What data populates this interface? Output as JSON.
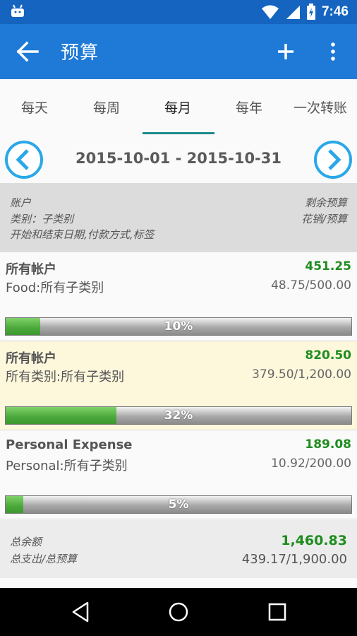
{
  "status": {
    "time": "7:46"
  },
  "appbar": {
    "title": "预算"
  },
  "tabs": [
    "每天",
    "每周",
    "每月",
    "每年",
    "一次转账"
  ],
  "active_tab": 2,
  "date_range": "2015-10-01 - 2015-10-31",
  "header": {
    "left_line1": "账户",
    "left_line2": "类别：子类别",
    "left_line3": "开始和结束日期,付款方式,标签",
    "right_line1": "剩余预算",
    "right_line2": "花销/预算"
  },
  "budgets": [
    {
      "account": "所有帐户",
      "category": "Food:所有子类别",
      "remaining": "451.25",
      "ratio": "48.75/500.00",
      "percent_label": "10%",
      "fill_fraction": 0.1,
      "highlighted": false
    },
    {
      "account": "所有帐户",
      "category": "所有类别:所有子类别",
      "remaining": "820.50",
      "ratio": "379.50/1,200.00",
      "percent_label": "32%",
      "fill_fraction": 0.32,
      "highlighted": true
    },
    {
      "account": "Personal Expense",
      "category": "Personal:所有子类别",
      "remaining": "189.08",
      "ratio": "10.92/200.00",
      "percent_label": "5%",
      "fill_fraction": 0.05,
      "highlighted": false
    }
  ],
  "totals": {
    "label1": "总余额",
    "label2": "总支出/总预算",
    "total_remaining": "1,460.83",
    "spent_ratio": "439.17/1,900.00"
  },
  "colors": {
    "primary": "#1e7ad6",
    "status": "#1565c0",
    "green": "#1f8c1f",
    "highlight": "#fdf7dc"
  }
}
